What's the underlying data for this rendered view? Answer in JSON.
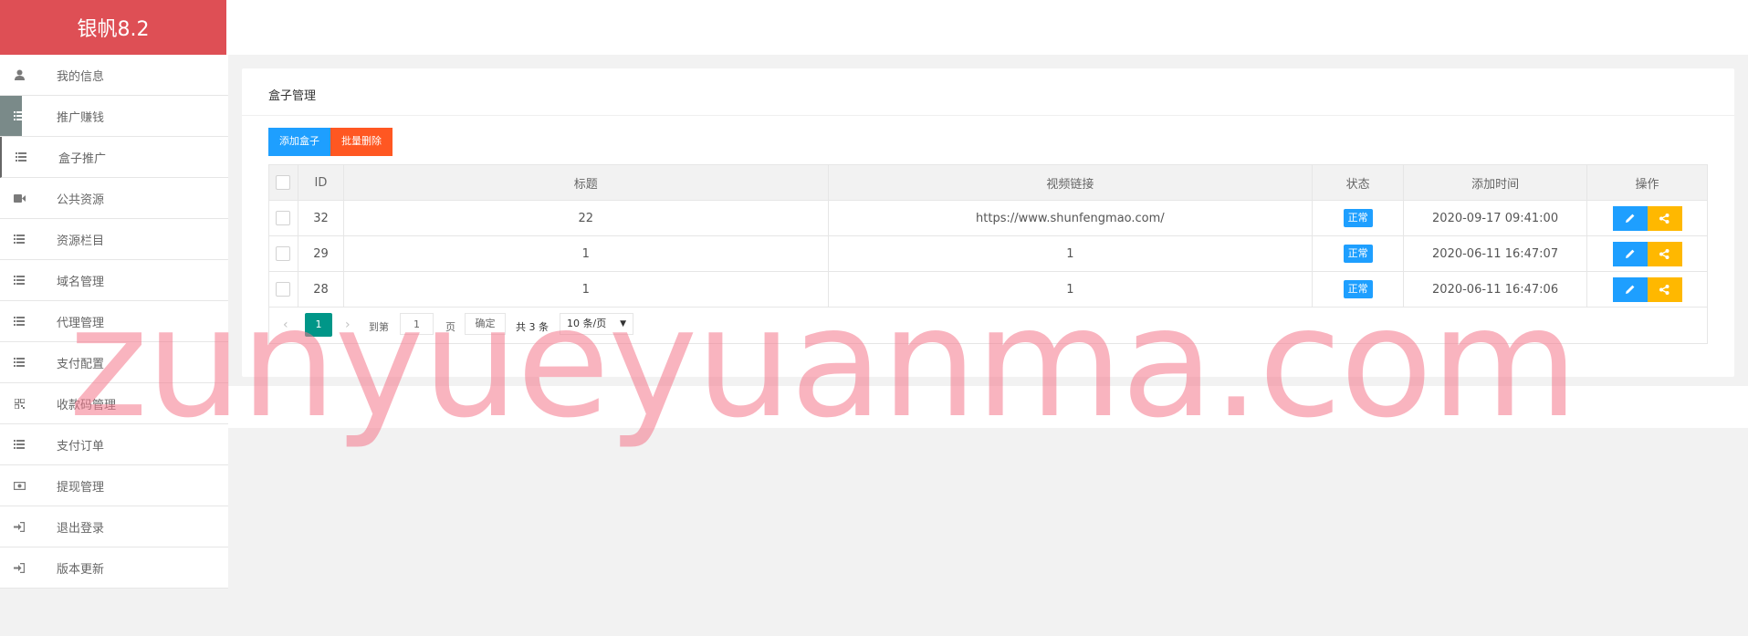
{
  "brand": {
    "title": "银帆8.2"
  },
  "sidebar": {
    "items": [
      {
        "label": "我的信息",
        "icon": "user-icon"
      },
      {
        "label": "推广赚钱",
        "icon": "list-icon"
      },
      {
        "label": "盒子推广",
        "icon": "list-icon"
      },
      {
        "label": "公共资源",
        "icon": "video-camera-icon"
      },
      {
        "label": "资源栏目",
        "icon": "list-icon"
      },
      {
        "label": "域名管理",
        "icon": "list-icon"
      },
      {
        "label": "代理管理",
        "icon": "list-icon"
      },
      {
        "label": "支付配置",
        "icon": "list-icon"
      },
      {
        "label": "收款码管理",
        "icon": "qrcode-icon"
      },
      {
        "label": "支付订单",
        "icon": "list-icon"
      },
      {
        "label": "提现管理",
        "icon": "money-icon"
      },
      {
        "label": "退出登录",
        "icon": "sign-in-icon"
      },
      {
        "label": "版本更新",
        "icon": "sign-in-icon"
      }
    ]
  },
  "main": {
    "card_title": "盒子管理",
    "toolbar": {
      "add_label": "添加盒子",
      "batch_delete_label": "批量删除"
    },
    "table": {
      "columns": [
        "ID",
        "标题",
        "视频链接",
        "状态",
        "添加时间",
        "操作"
      ],
      "rows": [
        {
          "id": "32",
          "title": "22",
          "video_link": "https://www.shunfengmao.com/",
          "status": "正常",
          "added": "2020-09-17 09:41:00"
        },
        {
          "id": "29",
          "title": "1",
          "video_link": "1",
          "status": "正常",
          "added": "2020-06-11 16:47:07"
        },
        {
          "id": "28",
          "title": "1",
          "video_link": "1",
          "status": "正常",
          "added": "2020-06-11 16:47:06"
        }
      ]
    },
    "pager": {
      "current_page": "1",
      "goto_label": "到第",
      "goto_value": "1",
      "page_unit": "页",
      "confirm_label": "确定",
      "total_label": "共 3 条",
      "page_size": "10 条/页"
    }
  },
  "watermark": "zunyueyuanma.com",
  "colors": {
    "brand_bg": "#de4f55",
    "primary": "#1e9fff",
    "danger": "#ff5722",
    "warning": "#ffb800",
    "pager_active": "#009688"
  }
}
